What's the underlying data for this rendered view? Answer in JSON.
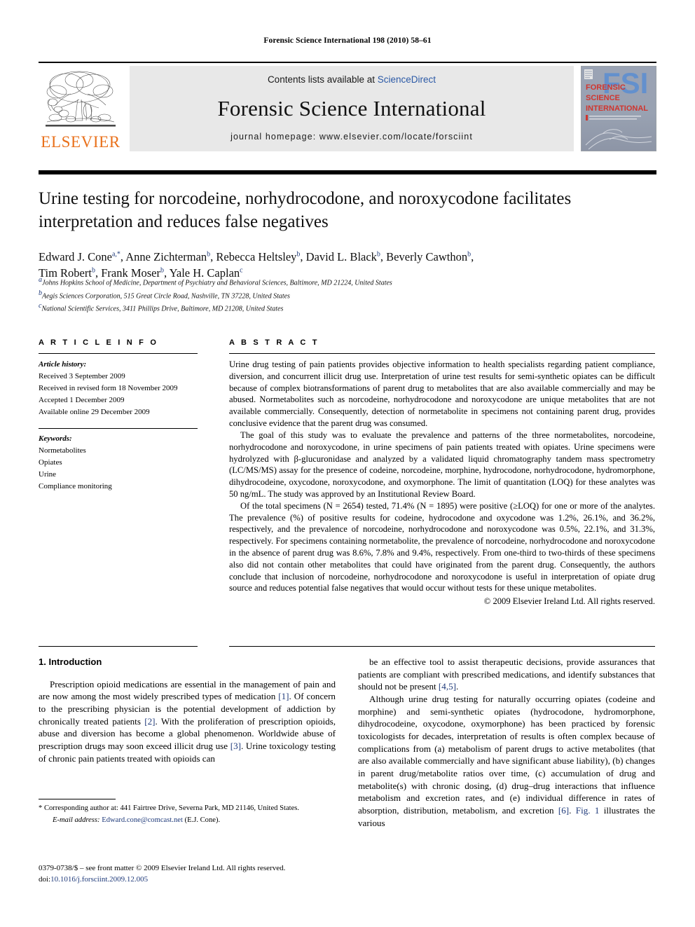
{
  "running_head": "Forensic Science International 198 (2010) 58–61",
  "masthead": {
    "contents_prefix": "Contents lists available at ",
    "sciencedirect": "ScienceDirect",
    "journal_title": "Forensic Science International",
    "homepage": "journal homepage: www.elsevier.com/locate/forsciint",
    "publisher_wordmark": "ELSEVIER",
    "publisher_color": "#E9711C",
    "link_color": "#2b59a6",
    "cover_lines": [
      "FORENSIC",
      "SCIENCE",
      "INTERNATIONAL"
    ],
    "cover_monogram": "FSI"
  },
  "article": {
    "title": "Urine testing for norcodeine, norhydrocodone, and noroxycodone facilitates interpretation and reduces false negatives",
    "authors_line_1_parts": [
      {
        "name": "Edward J. Cone",
        "marks": "a,*"
      },
      {
        "name": "Anne Zichterman",
        "marks": "b"
      },
      {
        "name": "Rebecca Heltsley",
        "marks": "b"
      },
      {
        "name": "David L. Black",
        "marks": "b"
      },
      {
        "name": "Beverly Cawthon",
        "marks": "b"
      }
    ],
    "authors_line_2_parts": [
      {
        "name": "Tim Robert",
        "marks": "b"
      },
      {
        "name": "Frank Moser",
        "marks": "b"
      },
      {
        "name": "Yale H. Caplan",
        "marks": "c"
      }
    ],
    "affiliations": [
      {
        "mark": "a",
        "text": "Johns Hopkins School of Medicine, Department of Psychiatry and Behavioral Sciences, Baltimore, MD 21224, United States"
      },
      {
        "mark": "b",
        "text": "Aegis Sciences Corporation, 515 Great Circle Road, Nashville, TN 37228, United States"
      },
      {
        "mark": "c",
        "text": "National Scientific Services, 3411 Phillips Drive, Baltimore, MD 21208, United States"
      }
    ]
  },
  "article_info": {
    "heading": "A R T I C L E   I N F O",
    "history_label": "Article history:",
    "history": [
      "Received 3 September 2009",
      "Received in revised form 18 November 2009",
      "Accepted 1 December 2009",
      "Available online 29 December 2009"
    ],
    "keywords_label": "Keywords:",
    "keywords": [
      "Normetabolites",
      "Opiates",
      "Urine",
      "Compliance monitoring"
    ]
  },
  "abstract": {
    "heading": "A B S T R A C T",
    "paragraphs": [
      "Urine drug testing of pain patients provides objective information to health specialists regarding patient compliance, diversion, and concurrent illicit drug use. Interpretation of urine test results for semi-synthetic opiates can be difficult because of complex biotransformations of parent drug to metabolites that are also available commercially and may be abused. Normetabolites such as norcodeine, norhydrocodone and noroxycodone are unique metabolites that are not available commercially. Consequently, detection of normetabolite in specimens not containing parent drug, provides conclusive evidence that the parent drug was consumed.",
      "The goal of this study was to evaluate the prevalence and patterns of the three normetabolites, norcodeine, norhydrocodone and noroxycodone, in urine specimens of pain patients treated with opiates. Urine specimens were hydrolyzed with β-glucuronidase and analyzed by a validated liquid chromatography tandem mass spectrometry (LC/MS/MS) assay for the presence of codeine, norcodeine, morphine, hydrocodone, norhydrocodone, hydromorphone, dihydrocodeine, oxycodone, noroxycodone, and oxymorphone. The limit of quantitation (LOQ) for these analytes was 50 ng/mL. The study was approved by an Institutional Review Board.",
      "Of the total specimens (N = 2654) tested, 71.4% (N = 1895) were positive (≥LOQ) for one or more of the analytes. The prevalence (%) of positive results for codeine, hydrocodone and oxycodone was 1.2%, 26.1%, and 36.2%, respectively, and the prevalence of norcodeine, norhydrocodone and noroxycodone was 0.5%, 22.1%, and 31.3%, respectively. For specimens containing normetabolite, the prevalence of norcodeine, norhydrocodone and noroxycodone in the absence of parent drug was 8.6%, 7.8% and 9.4%, respectively. From one-third to two-thirds of these specimens also did not contain other metabolites that could have originated from the parent drug. Consequently, the authors conclude that inclusion of norcodeine, norhydrocodone and noroxycodone is useful in interpretation of opiate drug source and reduces potential false negatives that would occur without tests for these unique metabolites."
    ],
    "copyright": "© 2009 Elsevier Ireland Ltd. All rights reserved."
  },
  "body": {
    "section_number_title": "1. Introduction",
    "left_paragraph_parts": [
      {
        "t": "Prescription opioid medications are essential in the management of pain and are now among the most widely prescribed types of medication "
      },
      {
        "t": "[1]",
        "ref": true
      },
      {
        "t": ". Of concern to the prescribing physician is the potential development of addiction by chronically treated patients "
      },
      {
        "t": "[2]",
        "ref": true
      },
      {
        "t": ". With the proliferation of prescription opioids, abuse and diversion has become a global phenomenon. Worldwide abuse of prescription drugs may soon exceed illicit drug use "
      },
      {
        "t": "[3]",
        "ref": true
      },
      {
        "t": ". Urine toxicology testing of chronic pain patients treated with opioids can"
      }
    ],
    "right_paragraph_1_parts": [
      {
        "t": "be an effective tool to assist therapeutic decisions, provide assurances that patients are compliant with prescribed medications, and identify substances that should not be present "
      },
      {
        "t": "[4,5]",
        "ref": true
      },
      {
        "t": "."
      }
    ],
    "right_paragraph_2_parts": [
      {
        "t": "Although urine drug testing for naturally occurring opiates (codeine and morphine) and semi-synthetic opiates (hydrocodone, hydromorphone, dihydrocodeine, oxycodone, oxymorphone) has been practiced by forensic toxicologists for decades, interpretation of results is often complex because of complications from (a) metabolism of parent drugs to active metabolites (that are also available commercially and have significant abuse liability), (b) changes in parent drug/metabolite ratios over time, (c) accumulation of drug and metabolite(s) with chronic dosing, (d) drug–drug interactions that influence metabolism and excretion rates, and (e) individual difference in rates of absorption, distribution, metabolism, and excretion "
      },
      {
        "t": "[6]",
        "ref": true
      },
      {
        "t": ". "
      },
      {
        "t": "Fig. 1",
        "ref": true
      },
      {
        "t": " illustrates the various"
      }
    ]
  },
  "footnotes": {
    "corresponding": "* Corresponding author at: 441 Fairtree Drive, Severna Park, MD 21146, United States.",
    "email_label": "E-mail address:",
    "email": "Edward.cone@comcast.net",
    "email_suffix": "(E.J. Cone)."
  },
  "imprint": {
    "line1": "0379-0738/$ – see front matter © 2009 Elsevier Ireland Ltd. All rights reserved.",
    "doi_label": "doi:",
    "doi": "10.1016/j.forsciint.2009.12.005"
  }
}
